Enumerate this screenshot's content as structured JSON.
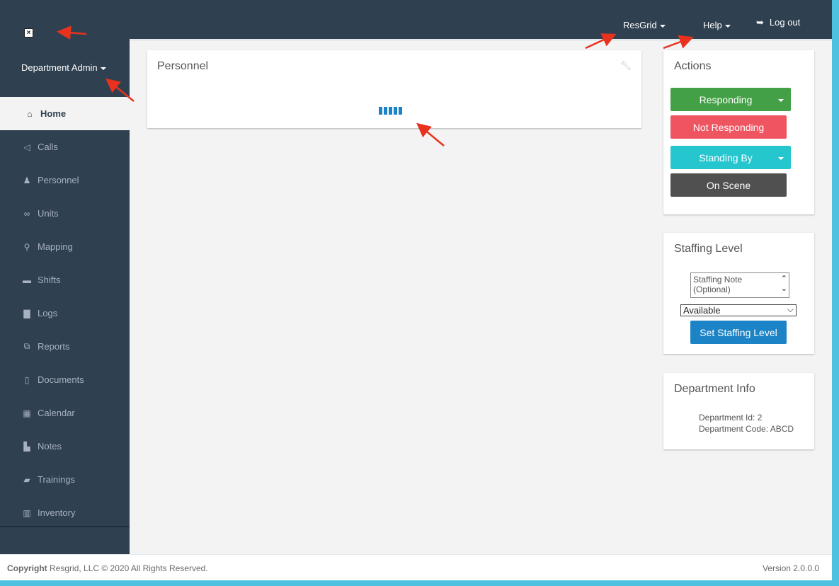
{
  "sidebar": {
    "profile_name": "Department Admin",
    "items": [
      {
        "label": "Home",
        "icon": "home-icon",
        "glyph": "⌂"
      },
      {
        "label": "Calls",
        "icon": "bullhorn-icon",
        "glyph": "◁"
      },
      {
        "label": "Personnel",
        "icon": "user-icon",
        "glyph": "♟"
      },
      {
        "label": "Units",
        "icon": "binoculars-icon",
        "glyph": "∞"
      },
      {
        "label": "Mapping",
        "icon": "map-marker-icon",
        "glyph": "⚲"
      },
      {
        "label": "Shifts",
        "icon": "briefcase-icon",
        "glyph": "▬"
      },
      {
        "label": "Logs",
        "icon": "file-icon",
        "glyph": "▇"
      },
      {
        "label": "Reports",
        "icon": "copy-icon",
        "glyph": "⧉"
      },
      {
        "label": "Documents",
        "icon": "document-icon",
        "glyph": "▯"
      },
      {
        "label": "Calendar",
        "icon": "calendar-icon",
        "glyph": "▦"
      },
      {
        "label": "Notes",
        "icon": "notes-icon",
        "glyph": "▙"
      },
      {
        "label": "Trainings",
        "icon": "book-icon",
        "glyph": "▰"
      },
      {
        "label": "Inventory",
        "icon": "barcode-icon",
        "glyph": "▥"
      }
    ],
    "active_index": 0
  },
  "topbar": {
    "resgrid_label": "ResGrid",
    "help_label": "Help",
    "logout_label": "Log out"
  },
  "personnel_panel": {
    "title": "Personnel"
  },
  "actions_panel": {
    "title": "Actions",
    "responding": "Responding",
    "not_responding": "Not Responding",
    "standing_by": "Standing By",
    "on_scene": "On Scene"
  },
  "staffing_panel": {
    "title": "Staffing Level",
    "note_placeholder": "Staffing Note (Optional)",
    "selected": "Available",
    "set_button": "Set Staffing Level"
  },
  "department_panel": {
    "title": "Department Info",
    "dept_id": "Department Id: 2",
    "dept_code": "Department Code: ABCD"
  },
  "footer": {
    "copyright_bold": "Copyright",
    "copyright_text": "Resgrid, LLC © 2020 All Rights Reserved.",
    "version": "Version 2.0.0.0"
  },
  "colors": {
    "sidebar": "#2f4050",
    "responding": "#43a047",
    "not_responding": "#ef5461",
    "standing_by": "#26c6cf",
    "on_scene": "#505050",
    "primary": "#1c84c6",
    "annotation_arrow": "#e8321e"
  }
}
